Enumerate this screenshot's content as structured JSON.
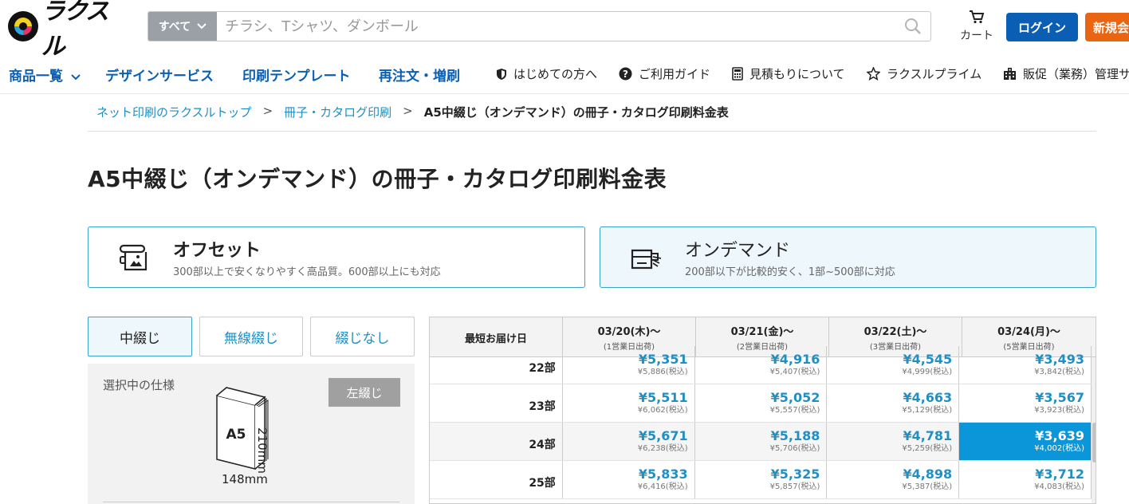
{
  "header": {
    "logo_text": "ラクスル",
    "search_category": "すべて",
    "search_placeholder": "チラシ、Tシャツ、ダンボール",
    "cart_label": "カート",
    "login_label": "ログイン",
    "signup_label": "新規会員登録"
  },
  "nav": {
    "main": [
      "商品一覧",
      "デザインサービス",
      "印刷テンプレート",
      "再注文・増刷"
    ],
    "sub": [
      "はじめての方へ",
      "ご利用ガイド",
      "見積もりについて",
      "ラクスルプライム",
      "販促（業務）管理サービス"
    ]
  },
  "breadcrumb": {
    "items": [
      "ネット印刷のラクスルトップ",
      "冊子・カタログ印刷"
    ],
    "current": "A5中綴じ（オンデマンド）の冊子・カタログ印刷料金表",
    "separator": ">"
  },
  "page_title": "A5中綴じ（オンデマンド）の冊子・カタログ印刷料金表",
  "methods": {
    "offset": {
      "title": "オフセット",
      "desc": "300部以上で安くなりやすく高品質。600部以上にも対応"
    },
    "ondemand": {
      "title": "オンデマンド",
      "desc": "200部以下が比較的安く、1部~500部に対応"
    }
  },
  "binding_tabs": [
    "中綴じ",
    "無線綴じ",
    "綴じなし"
  ],
  "spec": {
    "label": "選択中の仕様",
    "binding_button": "左綴じ",
    "size": "A5",
    "width": "148mm",
    "height": "210mm"
  },
  "price_table": {
    "header_first": "最短お届け日",
    "columns": [
      {
        "date": "03/20(木)～",
        "note": "(1営業日出荷)"
      },
      {
        "date": "03/21(金)～",
        "note": "(2営業日出荷)"
      },
      {
        "date": "03/22(土)～",
        "note": "(3営業日出荷)"
      },
      {
        "date": "03/24(月)～",
        "note": "(5営業日出荷)"
      }
    ],
    "rows": [
      {
        "qty": "22部",
        "prices": [
          {
            "main": "¥5,351",
            "tax": "¥5,886(税込)"
          },
          {
            "main": "¥4,916",
            "tax": "¥5,407(税込)"
          },
          {
            "main": "¥4,545",
            "tax": "¥4,999(税込)"
          },
          {
            "main": "¥3,493",
            "tax": "¥3,842(税込)"
          }
        ]
      },
      {
        "qty": "23部",
        "prices": [
          {
            "main": "¥5,511",
            "tax": "¥6,062(税込)"
          },
          {
            "main": "¥5,052",
            "tax": "¥5,557(税込)"
          },
          {
            "main": "¥4,663",
            "tax": "¥5,129(税込)"
          },
          {
            "main": "¥3,567",
            "tax": "¥3,923(税込)"
          }
        ]
      },
      {
        "qty": "24部",
        "prices": [
          {
            "main": "¥5,671",
            "tax": "¥6,238(税込)"
          },
          {
            "main": "¥5,188",
            "tax": "¥5,706(税込)"
          },
          {
            "main": "¥4,781",
            "tax": "¥5,259(税込)"
          },
          {
            "main": "¥3,639",
            "tax": "¥4,002(税込)"
          }
        ]
      },
      {
        "qty": "25部",
        "prices": [
          {
            "main": "¥5,833",
            "tax": "¥6,416(税込)"
          },
          {
            "main": "¥5,325",
            "tax": "¥5,857(税込)"
          },
          {
            "main": "¥4,898",
            "tax": "¥5,387(税込)"
          },
          {
            "main": "¥3,712",
            "tax": "¥4,083(税込)"
          }
        ]
      }
    ],
    "selected": {
      "row": 2,
      "col": 3
    }
  },
  "colors": {
    "brand_blue": "#0a5fb4",
    "accent_orange": "#ea6512",
    "link_blue": "#1f8fc4",
    "selected_cell": "#0a96d8"
  }
}
